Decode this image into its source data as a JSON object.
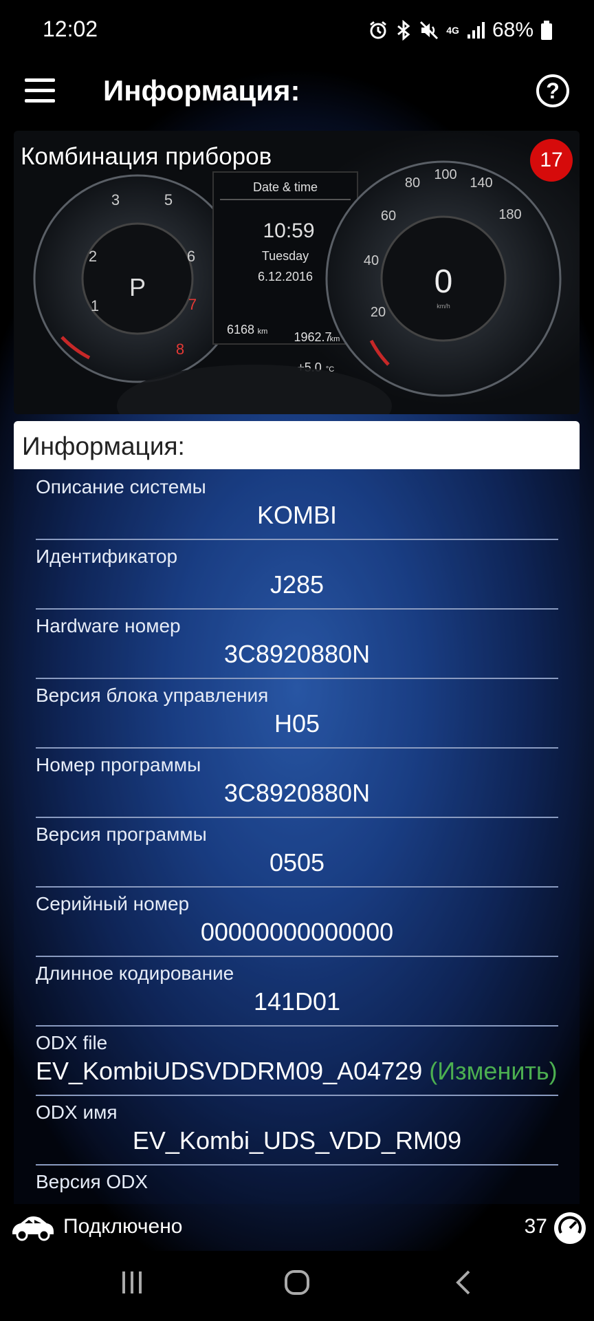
{
  "status": {
    "time": "12:02",
    "network": "4G",
    "battery": "68%"
  },
  "appbar": {
    "title": "Информация:"
  },
  "header": {
    "title": "Комбинация приборов",
    "badge": "17"
  },
  "info": {
    "section_title": "Информация:",
    "rows": [
      {
        "label": "Описание системы",
        "value": "KOMBI"
      },
      {
        "label": "Идентификатор",
        "value": "J285"
      },
      {
        "label": "Hardware номер",
        "value": "3C8920880N"
      },
      {
        "label": "Версия блока управления",
        "value": "H05"
      },
      {
        "label": "Номер программы",
        "value": "3C8920880N"
      },
      {
        "label": "Версия программы",
        "value": "0505"
      },
      {
        "label": "Серийный номер",
        "value": "00000000000000"
      },
      {
        "label": "Длинное кодирование",
        "value": "141D01"
      },
      {
        "label": "ODX file",
        "value": "EV_KombiUDSVDDRM09_A04729",
        "action": "(Изменить)"
      },
      {
        "label": "ODX имя",
        "value": "EV_Kombi_UDS_VDD_RM09"
      },
      {
        "label": "Версия ODX",
        "value": ""
      }
    ]
  },
  "dashboard": {
    "panel_title": "Date & time",
    "time": "10:59",
    "day": "Tuesday",
    "date": "6.12.2016",
    "odometer": "6168",
    "trip": "1962.7",
    "distance_unit": "km",
    "temperature": "+5.0",
    "temperature_unit": "°C",
    "gear": "P",
    "speed": "0",
    "speed_unit": "km/h",
    "rpm_ticks": [
      "1",
      "2",
      "3",
      "5",
      "6",
      "7",
      "8"
    ],
    "speed_ticks": [
      "20",
      "40",
      "60",
      "80",
      "100",
      "140",
      "180"
    ]
  },
  "footer": {
    "connection": "Подключено",
    "count": "37"
  },
  "colors": {
    "badge": "#d60b0b",
    "action_link": "#4caf50",
    "divider": "#8a9bc0"
  }
}
